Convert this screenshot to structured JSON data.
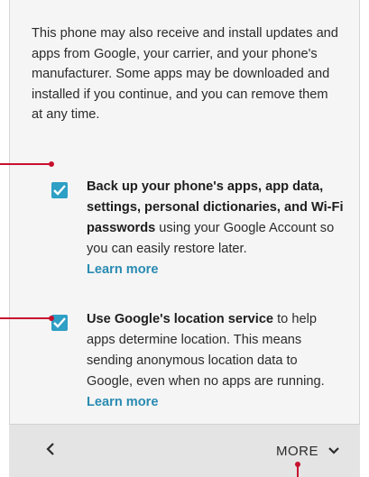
{
  "intro_text": "This phone may also receive and install updates and apps from Google, your carrier, and your phone's manufacturer. Some apps may be downloaded and installed if you continue, and you can remove them at any time.",
  "options": [
    {
      "checked": true,
      "bold_text": "Back up your phone's apps, app data, settings, personal dictionaries, and Wi-Fi passwords",
      "rest_text": " using your Google Account so you can easily restore later.",
      "link_text": "Learn more"
    },
    {
      "checked": true,
      "bold_text": "Use Google's location service",
      "rest_text": " to help apps determine location. This means sending anonymous location data to Google, even when no apps are running.",
      "link_text": "Learn more"
    }
  ],
  "nav": {
    "back_icon": "chevron-left-icon",
    "back_glyph": "<",
    "more_label": "MORE",
    "more_icon": "chevron-down-icon"
  },
  "colors": {
    "accent": "#2e9fc5",
    "link": "#2a8bb2",
    "callout": "#c8102e"
  }
}
